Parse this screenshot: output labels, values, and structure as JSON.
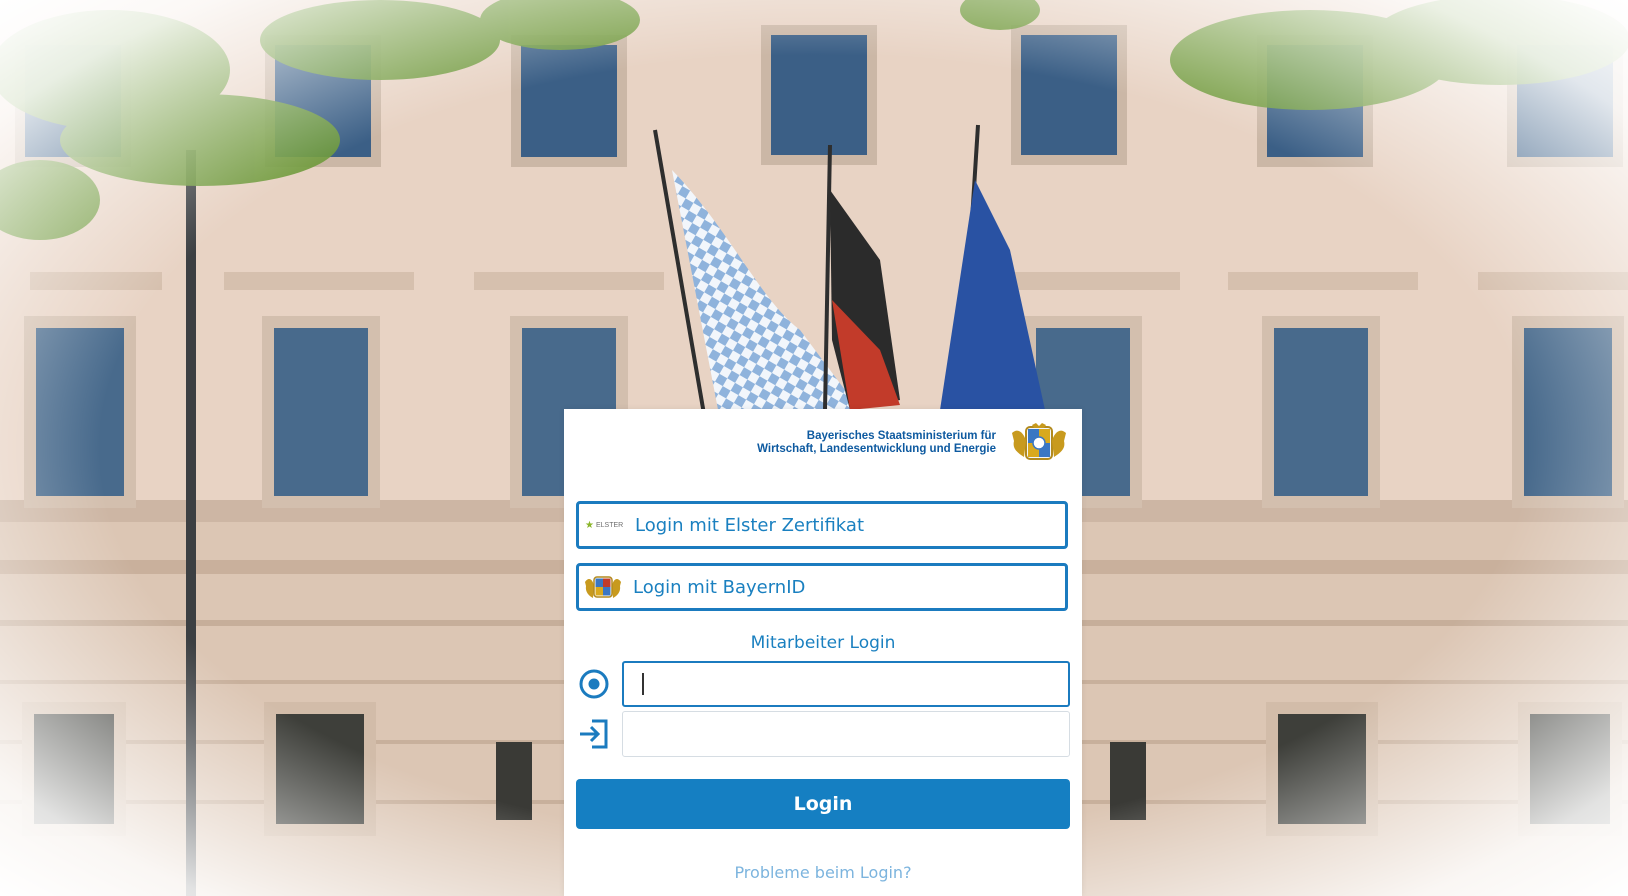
{
  "ministry": {
    "line1": "Bayerisches Staatsministerium für",
    "line2": "Wirtschaft, Landesentwicklung und Energie"
  },
  "elster_button": {
    "badge": "ELSTER",
    "label": "Login mit Elster Zertifikat"
  },
  "bayernid_button": {
    "label": "Login mit BayernID"
  },
  "employee_login": {
    "title": "Mitarbeiter Login",
    "username": {
      "value": "",
      "placeholder": ""
    },
    "password": {
      "value": "",
      "placeholder": ""
    }
  },
  "login_button": {
    "label": "Login"
  },
  "problems_link": {
    "label": "Probleme beim Login?"
  },
  "colors": {
    "accent": "#157fc2",
    "link_light": "#7cb4de"
  },
  "icons": [
    "crest-icon",
    "elster-icon",
    "bayern-coat-icon",
    "user-circle-icon",
    "sign-in-icon"
  ]
}
